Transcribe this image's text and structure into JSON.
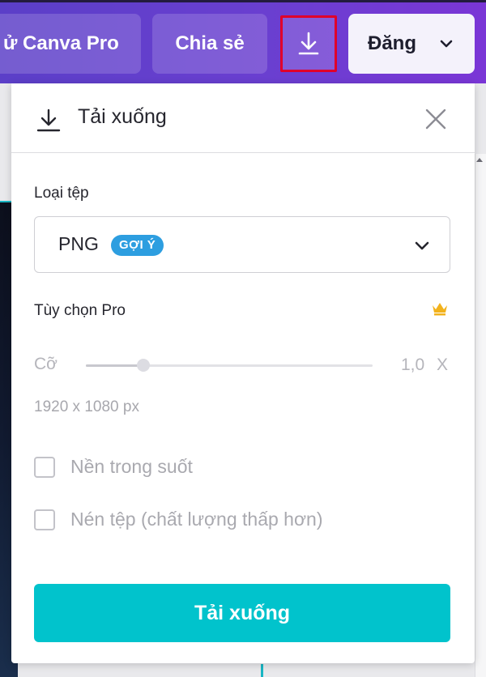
{
  "topbar": {
    "pro_label": "ử Canva Pro",
    "share_label": "Chia sẻ",
    "publish_label": "Đăng"
  },
  "panel": {
    "title": "Tải xuống",
    "file_type_label": "Loại tệp",
    "file_type_value": "PNG",
    "file_type_badge": "GỢI Ý",
    "pro_options_label": "Tùy chọn Pro",
    "size_label": "Cỡ",
    "size_value": "1,0",
    "size_unit": "X",
    "size_slider_fraction": 0.2,
    "dimensions": "1920 x 1080 px",
    "transparent_bg_label": "Nền trong suốt",
    "compress_label": "Nén tệp (chất lượng thấp hơn)",
    "download_button": "Tải xuống"
  },
  "icons": {
    "download": "download-icon",
    "close": "close-icon",
    "chevron": "chevron-down-icon",
    "crown": "crown-icon"
  },
  "colors": {
    "topbar": "#6a3fd0",
    "primary_button": "#01c3cc",
    "badge": "#2d9ee0",
    "crown": "#f2b21c",
    "highlight_border": "#e0002a"
  }
}
